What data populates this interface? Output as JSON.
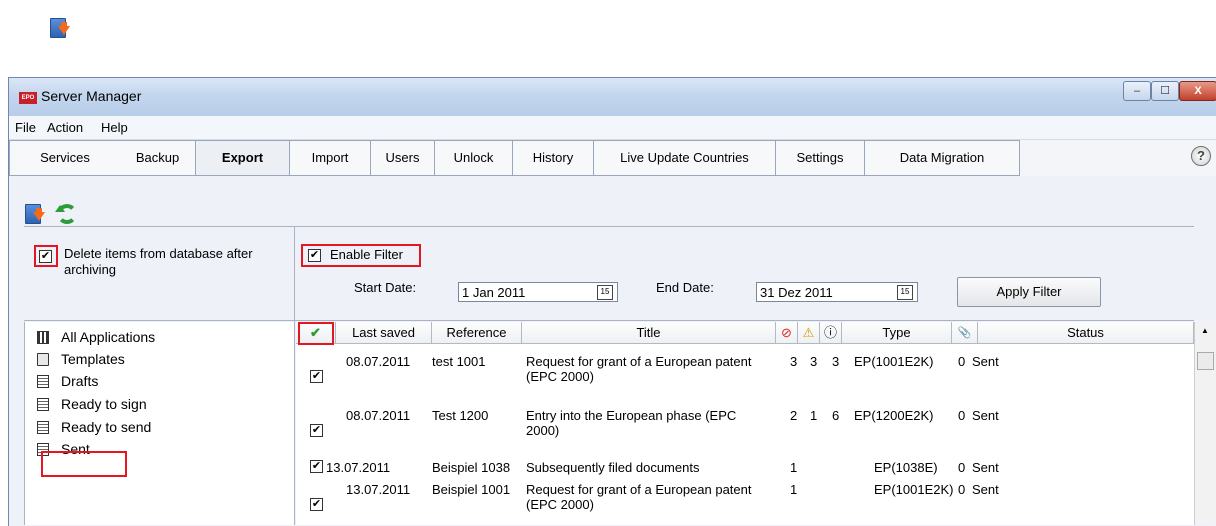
{
  "window": {
    "title": "Server Manager",
    "app_badge": "EPO",
    "controls": {
      "minimize": "–",
      "maximize": "☐",
      "close": "X"
    }
  },
  "menu": [
    "File",
    "Action",
    "Help"
  ],
  "tabs": [
    "Services",
    "Backup",
    "Export",
    "Import",
    "Users",
    "Unlock",
    "History",
    "Live Update Countries",
    "Settings",
    "Data Migration"
  ],
  "active_tab": "Export",
  "help": "?",
  "options": {
    "delete_items_label": "Delete items from database after archiving",
    "delete_items_checked": true,
    "enable_filter_label": "Enable Filter",
    "enable_filter_checked": true
  },
  "filter": {
    "start_date_label": "Start Date:",
    "start_date_value": "1 Jan 2011",
    "end_date_label": "End Date:",
    "end_date_value": "31 Dez 2011",
    "calendar_glyph": "15",
    "apply_label": "Apply Filter"
  },
  "folders": [
    {
      "label": "All Applications",
      "icon": "grid-icon"
    },
    {
      "label": "Templates",
      "icon": "template-icon"
    },
    {
      "label": "Drafts",
      "icon": "list-icon"
    },
    {
      "label": "Ready to sign",
      "icon": "list-icon"
    },
    {
      "label": "Ready to send",
      "icon": "list-icon"
    },
    {
      "label": "Sent",
      "icon": "list-icon",
      "selected": true
    }
  ],
  "table": {
    "columns": [
      "✔",
      "Last saved",
      "Reference",
      "Title",
      "⊘",
      "⚠",
      "ⓘ",
      "Type",
      "📎",
      "Status"
    ],
    "rows": [
      {
        "checked": true,
        "last_saved": "08.07.2011",
        "reference": "test 1001",
        "title": "Request for grant of a European patent (EPC 2000)",
        "c1": "3",
        "c2": "3",
        "c3": "3",
        "type": "EP(1001E2K)",
        "att": "0",
        "status": "Sent"
      },
      {
        "checked": true,
        "last_saved": "08.07.2011",
        "reference": "Test 1200",
        "title": "Entry into the European phase (EPC 2000)",
        "c1": "2",
        "c2": "1",
        "c3": "6",
        "type": "EP(1200E2K)",
        "att": "0",
        "status": "Sent"
      },
      {
        "checked": true,
        "last_saved": "13.07.2011",
        "reference": "Beispiel 1038",
        "title": "Subsequently filed documents",
        "c1": "1",
        "c2": "",
        "c3": "",
        "type": "EP(1038E)",
        "att": "0",
        "status": "Sent"
      },
      {
        "checked": true,
        "last_saved": "13.07.2011",
        "reference": "Beispiel 1001",
        "title": "Request for grant of a European patent (EPC 2000)",
        "c1": "1",
        "c2": "",
        "c3": "",
        "type": "EP(1001E2K)",
        "att": "0",
        "status": "Sent"
      }
    ]
  },
  "colors": {
    "highlight": "#e4161f",
    "check_green": "#2f9b3a",
    "export_orange": "#f26b1d"
  }
}
